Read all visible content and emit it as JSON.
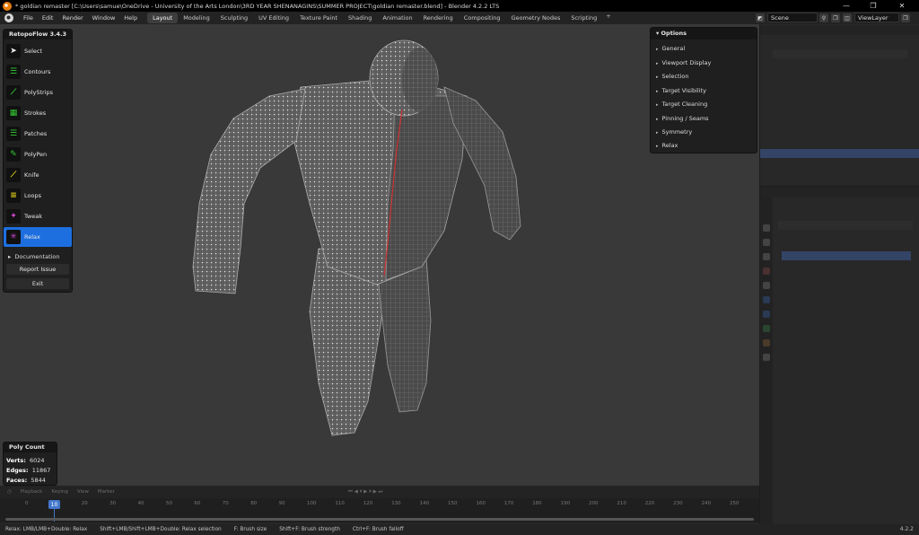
{
  "window": {
    "title": "* goldian remaster [C:\\Users\\samue\\OneDrive - University of the Arts London\\3RD YEAR SHENANAGINS\\SUMMER PROJECT\\goldian remaster.blend] - Blender 4.2.2 LTS",
    "minimize": "—",
    "maximize": "❐",
    "close": "✕"
  },
  "menubar": {
    "menus": [
      "File",
      "Edit",
      "Render",
      "Window",
      "Help"
    ],
    "workspaces": [
      "Layout",
      "Modeling",
      "Sculpting",
      "UV Editing",
      "Texture Paint",
      "Shading",
      "Animation",
      "Rendering",
      "Compositing",
      "Geometry Nodes",
      "Scripting"
    ],
    "active_workspace": "Layout",
    "add_workspace": "+",
    "scene": "Scene",
    "view_layer": "ViewLayer"
  },
  "retopoflow": {
    "title": "RetopoFlow 3.4.3",
    "tools": [
      {
        "label": "Select",
        "icon": "select-arrow-icon",
        "color": "#f2f2f2"
      },
      {
        "label": "Contours",
        "icon": "contours-icon",
        "color": "#33cc33"
      },
      {
        "label": "PolyStrips",
        "icon": "polystrips-icon",
        "color": "#33cc33"
      },
      {
        "label": "Strokes",
        "icon": "strokes-icon",
        "color": "#33cc33"
      },
      {
        "label": "Patches",
        "icon": "patches-icon",
        "color": "#33cc33"
      },
      {
        "label": "PolyPen",
        "icon": "polypen-icon",
        "color": "#33cc33"
      },
      {
        "label": "Knife",
        "icon": "knife-icon",
        "color": "#e6d619"
      },
      {
        "label": "Loops",
        "icon": "loops-icon",
        "color": "#e6d619"
      },
      {
        "label": "Tweak",
        "icon": "tweak-icon",
        "color": "#cc44cc"
      },
      {
        "label": "Relax",
        "icon": "relax-icon",
        "color": "#cc44cc"
      }
    ],
    "active_tool": "Relax",
    "documentation": "Documentation",
    "report_issue": "Report Issue",
    "exit": "Exit"
  },
  "options": {
    "title": "Options",
    "items": [
      "General",
      "Viewport Display",
      "Selection",
      "Target Visibility",
      "Target Cleaning",
      "Pinning / Seams",
      "Symmetry",
      "Relax"
    ]
  },
  "poly_count": {
    "title": "Poly Count",
    "verts_label": "Verts:",
    "verts": "6024",
    "edges_label": "Edges:",
    "edges": "11867",
    "faces_label": "Faces:",
    "faces": "5844"
  },
  "timeline": {
    "menus": [
      "Playback",
      "Keying",
      "View",
      "Marker"
    ],
    "current_frame": "10",
    "ticks": [
      "0",
      "10",
      "20",
      "30",
      "40",
      "50",
      "60",
      "70",
      "80",
      "90",
      "100",
      "110",
      "120",
      "130",
      "140",
      "150",
      "160",
      "170",
      "180",
      "190",
      "200",
      "210",
      "220",
      "230",
      "240",
      "250"
    ]
  },
  "statusbar": {
    "hints": [
      "Relax: LMB/LMB+Double: Relax",
      "Shift+LMB/Shift+LMB+Double: Relax selection",
      "F: Brush size",
      "Shift+F: Brush strength",
      "Ctrl+F: Brush falloff"
    ],
    "version": "4.2.2"
  },
  "colors": {
    "accent_blue": "#1d6fe0",
    "viewport_bg": "#393939",
    "seam": "#cc3333"
  }
}
